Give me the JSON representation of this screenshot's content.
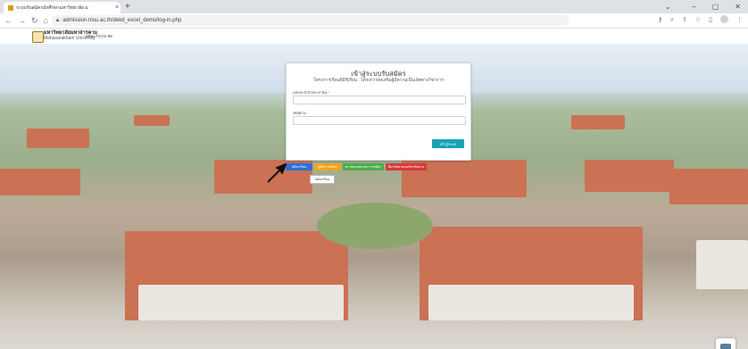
{
  "browser": {
    "tab_title": "ระบบรับสมัครนักศึกษามหาวิทยาลัย ม",
    "new_tab": "+",
    "close_tab": "×",
    "url": "admission.msu.ac.th/dekd_excel_demo/log-in.php"
  },
  "header": {
    "university_th": "มหาวิทยาลัยมหาสารคาม",
    "university_en": "Mahasarakham University",
    "system_name": "MSU-TCAS 66"
  },
  "login": {
    "title": "เข้าสู่ระบบรับสมัคร",
    "subtitle": "โครงการเรียนดีมีที่เรียน : โครงการส่งเสริมผู้มีความเป็นเลิศทางวิชาการ",
    "id_label": "เลขประจำตัวประชาชน",
    "password_label": "รหัสผ่าน",
    "required_mark": "*",
    "login_button": "เข้าสู่ระบบ"
  },
  "actions": {
    "register": "สมัครเรียน",
    "manual": "คู่มือการสมัคร",
    "check_status": "ตรวจสอบสถานะการสมัคร",
    "forgot": "ลืมรหัสผ่าน/ขอรับรหัสผ่าน",
    "small_button": "สมัครเรียน"
  },
  "colors": {
    "register": "#2f6fd8",
    "manual": "#f0a41a",
    "check_status": "#4cae4c",
    "forgot": "#d9383a",
    "login_button": "#17a2b8"
  }
}
